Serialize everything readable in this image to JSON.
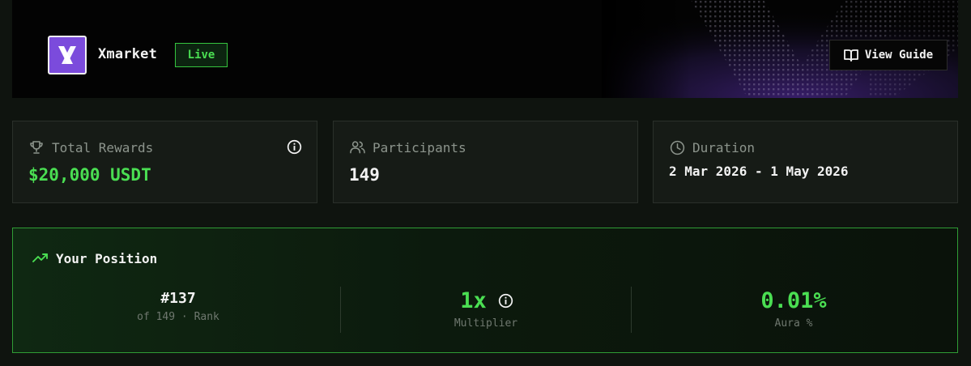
{
  "header": {
    "brand_name": "Xmarket",
    "status_badge": "Live",
    "guide_button_label": "View Guide",
    "logo_icon": "xmarket-logo",
    "guide_icon": "book-open-icon"
  },
  "stats": {
    "total_rewards": {
      "label": "Total Rewards",
      "value": "$20,000 USDT",
      "icon": "trophy-icon"
    },
    "participants": {
      "label": "Participants",
      "value": "149",
      "icon": "users-icon"
    },
    "duration": {
      "label": "Duration",
      "value": "2 Mar 2026 - 1 May 2026",
      "icon": "clock-icon"
    }
  },
  "position": {
    "title": "Your Position",
    "rank": {
      "value": "#137",
      "caption": "of 149 · Rank"
    },
    "multiplier": {
      "value": "1x",
      "caption": "Multiplier"
    },
    "aura": {
      "value": "0.01%",
      "caption": "Aura %"
    }
  },
  "colors": {
    "accent_green": "#4ade52",
    "badge_border": "#35c43e",
    "logo_purple": "#7b4bdc",
    "banner_glow": "#3a1f6e"
  }
}
